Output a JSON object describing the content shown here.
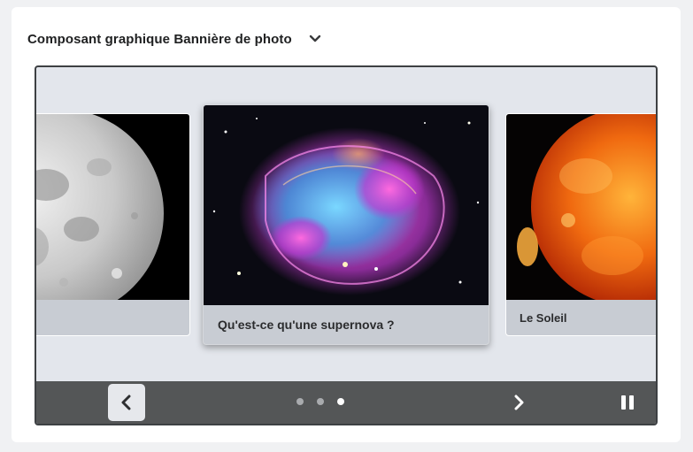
{
  "widget": {
    "title": "Composant graphique Bannière de photo",
    "collapse_icon": "chevron-down-icon"
  },
  "carousel": {
    "slides": [
      {
        "caption": "",
        "image": "moon"
      },
      {
        "caption": "Qu'est-ce qu'une supernova ?",
        "image": "supernova"
      },
      {
        "caption": "Le Soleil",
        "image": "sun"
      }
    ],
    "active_index": 3,
    "dot_count": 3,
    "prev_icon": "chevron-left-icon",
    "next_icon": "chevron-right-icon",
    "pause_icon": "pause-icon"
  },
  "colors": {
    "frame_border": "#3d4043",
    "stage_bg": "#e3e6ec",
    "controls_bg": "#545657",
    "caption_bg": "#c8ccd3"
  }
}
